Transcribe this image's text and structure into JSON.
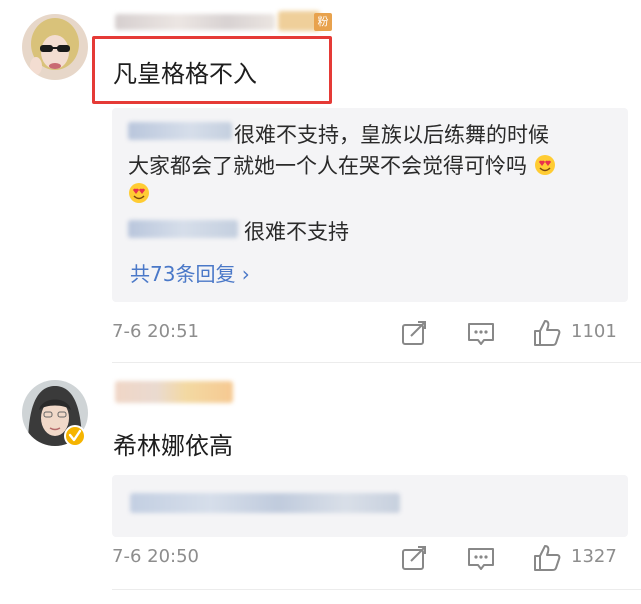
{
  "comments": [
    {
      "text": "凡皇格格不入",
      "badge": "粉",
      "reply_lines": [
        "很难不支持，皇族以后练舞的时候",
        "大家都会了就她一个人在哭不会觉得可怜吗"
      ],
      "reply_2_text": "很难不支持",
      "more_replies": "共73条回复 ›",
      "timestamp": "7-6 20:51",
      "likes": "1101"
    },
    {
      "text": "希林娜依高",
      "timestamp": "7-6 20:50",
      "likes": "1327"
    }
  ],
  "colors": {
    "highlight": "#e53a36",
    "link": "#4a78c8",
    "meta": "#8d8d8d",
    "reply_bg": "#f4f4f6",
    "verified_badge": "#f5b400"
  }
}
